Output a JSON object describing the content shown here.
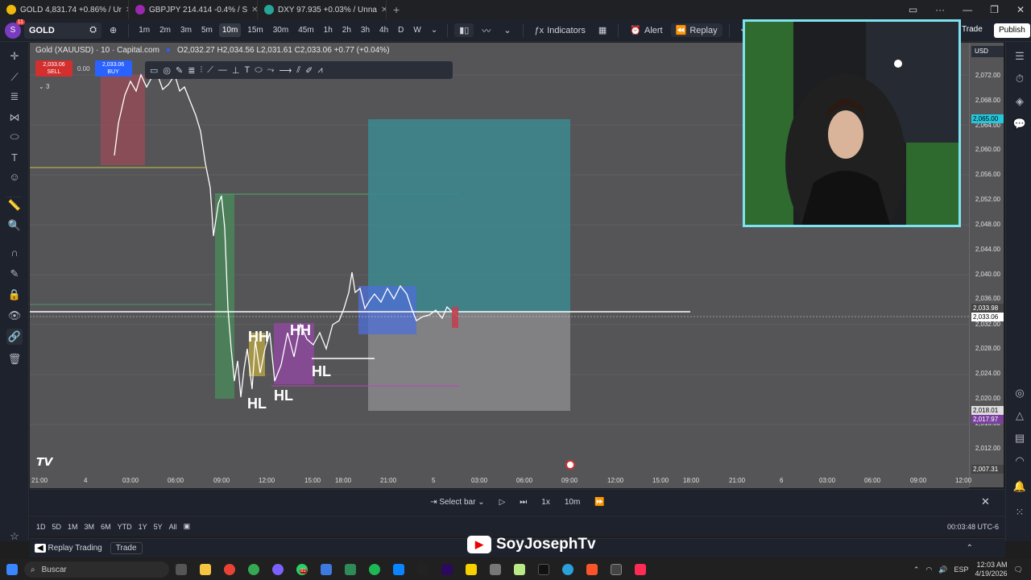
{
  "browser_tabs": [
    {
      "label": "GOLD  4,831.74 +0.86% / Ur",
      "color": "#f0b90b"
    },
    {
      "label": "GBPJPY  214.414 -0.4% / S",
      "color": "#9c27b0"
    },
    {
      "label": "DXY  97.935 +0.03% / Unna",
      "color": "#26a69a"
    }
  ],
  "toolbar": {
    "avatar_letter": "S",
    "avatar_badge": "11",
    "symbol": "GOLD",
    "timeframes": [
      "1m",
      "2m",
      "3m",
      "5m",
      "10m",
      "15m",
      "30m",
      "45m",
      "1h",
      "2h",
      "3h",
      "4h",
      "D",
      "W"
    ],
    "selected_timeframe": "10m",
    "indicators": "Indicators",
    "alert": "Alert",
    "replay": "Replay",
    "trade": "Trade",
    "publish": "Publish"
  },
  "chart_header": {
    "title": "Gold (XAUUSD) · 10 · Capital.com",
    "ohlc": "O2,032.27  H2,034.56  L2,031.61  C2,033.06  +0.77 (+0.04%)",
    "sell_price": "2,033.06",
    "sell_label": "SELL",
    "spread": "0.00",
    "buy_price": "2,033.06",
    "buy_label": "BUY",
    "indicator_count": "3"
  },
  "price_scale": {
    "currency": "USD",
    "labels": [
      "2,072.00",
      "2,068.00",
      "2,064.00",
      "2,060.00",
      "2,056.00",
      "2,052.00",
      "2,048.00",
      "2,044.00",
      "2,040.00",
      "2,036.00",
      "2,032.00",
      "2,028.00",
      "2,024.00",
      "2,020.00",
      "2,016.00",
      "2,012.00"
    ],
    "tag_target": "2,065.00",
    "tag_last_1": "2,033.98",
    "tag_last_2": "2,033.06",
    "tag_stop_1": "2,018.01",
    "tag_stop_2": "2,017.97",
    "tag_bottom": "2,007.31"
  },
  "time_scale": [
    "21:00",
    "4",
    "03:00",
    "06:00",
    "09:00",
    "12:00",
    "15:00",
    "18:00",
    "21:00",
    "5",
    "03:00",
    "06:00",
    "09:00",
    "12:00",
    "15:00",
    "18:00",
    "21:00",
    "6",
    "03:00",
    "06:00",
    "09:00",
    "12:00"
  ],
  "chart_labels": {
    "hh1": "HH",
    "hh2": "HH",
    "hl1": "HL",
    "hl2": "HL",
    "hl3": "HL"
  },
  "replay_bar": {
    "select_bar": "Select bar",
    "speed": "1x",
    "interval": "10m"
  },
  "range_bar": {
    "ranges": [
      "1D",
      "5D",
      "1M",
      "3M",
      "6M",
      "YTD",
      "1Y",
      "5Y",
      "All"
    ],
    "clock": "00:03:48 UTC-6"
  },
  "bottom_bar": {
    "replay_trading": "Replay Trading",
    "trade": "Trade"
  },
  "watermark": "SoyJosephTv",
  "taskbar": {
    "search": "Buscar",
    "lang": "ESP",
    "time": "12:03 AM",
    "date": "4/19/2026",
    "badge": "85"
  }
}
